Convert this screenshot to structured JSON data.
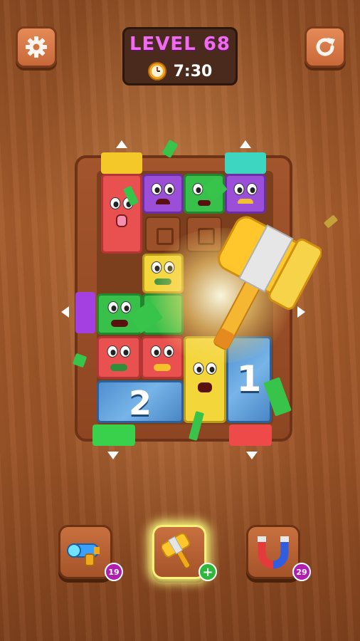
{
  "header": {
    "level_label": "LEVEL 68",
    "timer": "7:30"
  },
  "icons": {
    "settings": "gear-icon",
    "restart": "restart-icon",
    "timer": "clock-icon"
  },
  "board": {
    "blocks": [
      {
        "id": "red-tall",
        "color": "#e8514f"
      },
      {
        "id": "purple",
        "color": "#9b4fd8"
      },
      {
        "id": "green-top",
        "color": "#37c14a"
      },
      {
        "id": "purple-right",
        "color": "#9b4fd8"
      },
      {
        "id": "yellow-mid",
        "color": "#f2d63a"
      },
      {
        "id": "green-left",
        "color": "#37c14a"
      },
      {
        "id": "red-a",
        "color": "#e8514f"
      },
      {
        "id": "red-b",
        "color": "#e8514f"
      },
      {
        "id": "yellow-tall",
        "color": "#f2d63a"
      }
    ],
    "ice_blocks": [
      {
        "id": "ice-2",
        "number": "2"
      },
      {
        "id": "ice-1",
        "number": "1"
      }
    ],
    "exits": [
      "yellow",
      "teal",
      "purple",
      "green",
      "red"
    ]
  },
  "powerups": [
    {
      "name": "blaster",
      "count": "19",
      "icon": "blaster-icon"
    },
    {
      "name": "hammer",
      "icon": "hammer-icon",
      "badge": "+"
    },
    {
      "name": "magnet",
      "count": "29",
      "icon": "magnet-icon"
    }
  ]
}
